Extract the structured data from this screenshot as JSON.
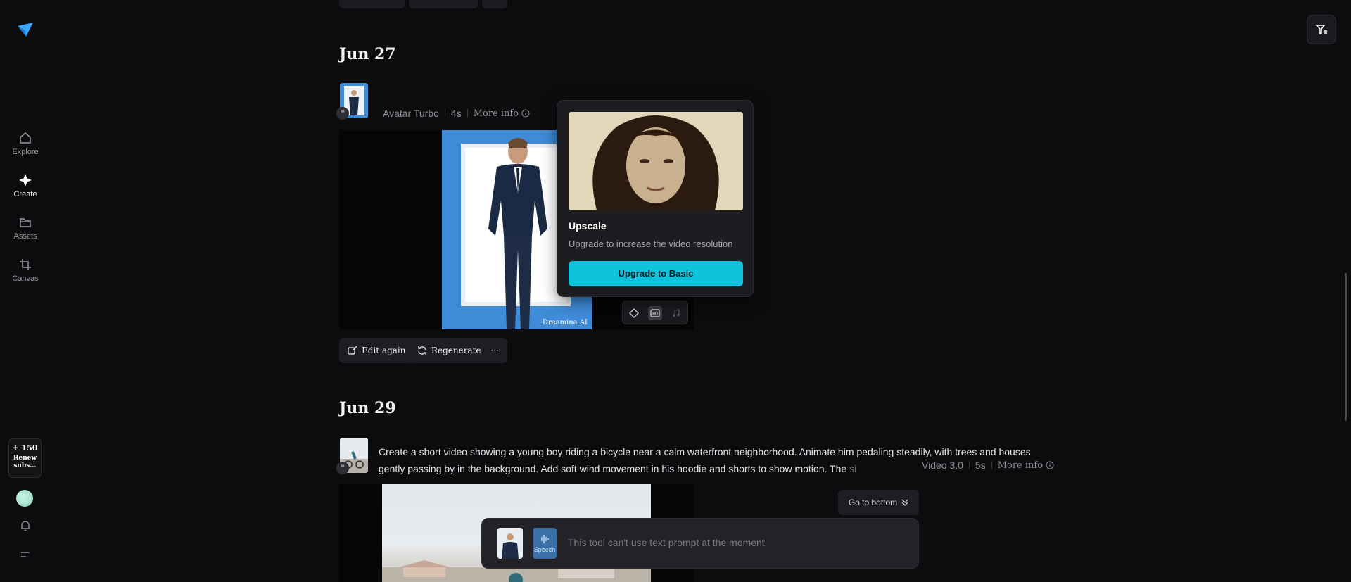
{
  "sidebar": {
    "logo": "dreamina-logo",
    "items": [
      {
        "label": "Explore",
        "icon": "home-icon"
      },
      {
        "label": "Create",
        "icon": "sparkle-icon"
      },
      {
        "label": "Assets",
        "icon": "folder-icon"
      },
      {
        "label": "Canvas",
        "icon": "crop-icon"
      }
    ],
    "credits": {
      "count": "+ 150",
      "renew": "Renew subs..."
    }
  },
  "sections": [
    {
      "date": "Jun 27",
      "model": "Avatar Turbo",
      "duration": "4s",
      "more_info": "More info",
      "watermark": "Dreamina AI",
      "actions": {
        "edit": "Edit again",
        "regenerate": "Regenerate",
        "more": "···"
      }
    },
    {
      "date": "Jun 29",
      "prompt": "Create a short video showing a young boy riding a bicycle near a calm waterfront neighborhood. Animate him pedaling steadily, with trees and houses gently passing by in the background. Add soft wind movement in his hoodie and shorts to show motion. The",
      "prompt_fade": "si",
      "model": "Video 3.0",
      "duration": "5s",
      "more_info": "More info"
    }
  ],
  "popover": {
    "title": "Upscale",
    "description": "Upgrade to increase the video resolution",
    "button": "Upgrade to Basic"
  },
  "go_bottom": "Go to bottom",
  "composer": {
    "speech_label": "Speech",
    "placeholder": "This tool can't use text prompt at the moment"
  },
  "colors": {
    "accent": "#0fc3dc",
    "background": "#0c0c0e"
  }
}
